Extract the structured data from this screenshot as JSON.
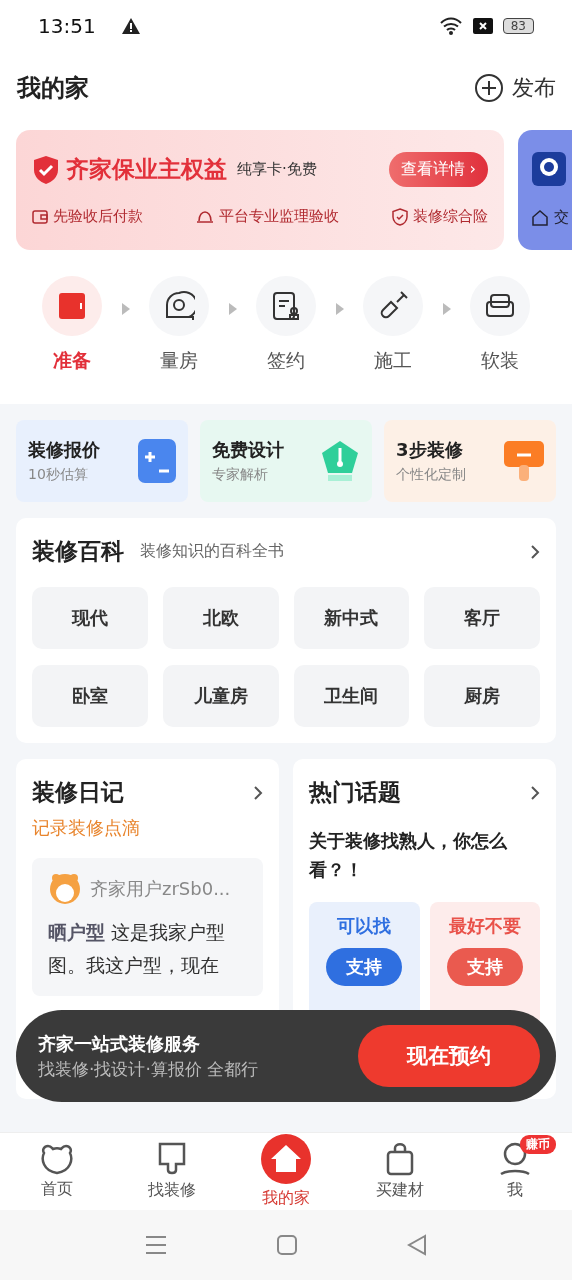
{
  "status_bar": {
    "time": "13:51",
    "battery": "83"
  },
  "header": {
    "title": "我的家",
    "publish": "发布"
  },
  "promo": {
    "title": "齐家保业主权益",
    "subtitle": "纯享卡·免费",
    "button": "查看详情 ›",
    "features": [
      "先验收后付款",
      "平台专业监理验收",
      "装修综合险"
    ],
    "next_card_text": "交"
  },
  "steps": [
    {
      "label": "准备",
      "selected": true
    },
    {
      "label": "量房",
      "selected": false
    },
    {
      "label": "签约",
      "selected": false
    },
    {
      "label": "施工",
      "selected": false
    },
    {
      "label": "软装",
      "selected": false
    }
  ],
  "quick_cards": [
    {
      "kind": "calc",
      "title": "装修报价",
      "subtitle": "10秒估算"
    },
    {
      "kind": "design",
      "title": "免费设计",
      "subtitle": "专家解析"
    },
    {
      "kind": "steps",
      "title": "3步装修",
      "subtitle": "个性化定制"
    }
  ],
  "encyclopedia": {
    "title": "装修百科",
    "subtitle": "装修知识的百科全书",
    "tags": [
      "现代",
      "北欧",
      "新中式",
      "客厅",
      "卧室",
      "儿童房",
      "卫生间",
      "厨房"
    ]
  },
  "diary": {
    "title": "装修日记",
    "subtitle": "记录装修点滴",
    "user": "齐家用户zrSb0...",
    "text": "**晒户型** 这是我家户型图。我这户型，现在"
  },
  "topic": {
    "title": "热门话题",
    "question": "关于装修找熟人，你怎么看？！",
    "options": [
      {
        "label": "可以找",
        "button": "支持",
        "kind": "pro"
      },
      {
        "label": "最好不要",
        "button": "支持",
        "kind": "con"
      }
    ]
  },
  "floating_banner": {
    "title": "齐家一站式装修服务",
    "subtitle": "找装修·找设计·算报价 全都行",
    "button": "现在预约"
  },
  "tab_bar": [
    {
      "label": "首页",
      "selected": false,
      "kind": "home"
    },
    {
      "label": "找装修",
      "selected": false,
      "kind": "find"
    },
    {
      "label": "我的家",
      "selected": true,
      "kind": "house"
    },
    {
      "label": "买建材",
      "selected": false,
      "kind": "shop"
    },
    {
      "label": "我",
      "selected": false,
      "kind": "me",
      "badge": "赚币"
    }
  ]
}
